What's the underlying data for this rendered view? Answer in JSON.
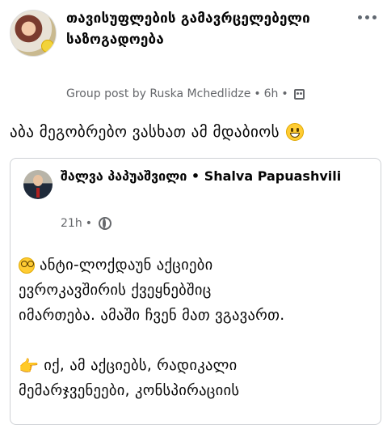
{
  "group": {
    "name": "თავისუფლების გამავრცელებელი საზოგადოება",
    "meta_text": "Group post by Ruska Mchedlidze",
    "separator": "•",
    "time": "6h",
    "separator2": "•"
  },
  "post": {
    "text": "აბა მეგობრებო ვასხათ ამ მდაბიოს"
  },
  "icons": {
    "more": "more-options-icon",
    "audience": "group-audience-icon",
    "post_emoji": "grinning-face-icon",
    "globe": "globe-icon",
    "dizzy": "dizzy-face-icon",
    "point": "pointing-right-icon"
  },
  "shared": {
    "author": "შალვა პაპუაშვილი • Shalva Papuashvili",
    "time": "21h",
    "separator": "•",
    "lines": [
      "ანტი-ლოქდაუნ აქციები",
      "ევროკავშირის ქვეყნებშიც",
      "იმართება. ამაში ჩვენ მათ ვგავართ.",
      "",
      "იქ, ამ აქციებს, რადიკალი",
      "მემარჯვენეები, კონსპირაციის"
    ]
  },
  "colors": {
    "secondary_text": "#65676b",
    "card_border": "#cfd2d6",
    "emoji_yellow": "#ffcc33"
  }
}
